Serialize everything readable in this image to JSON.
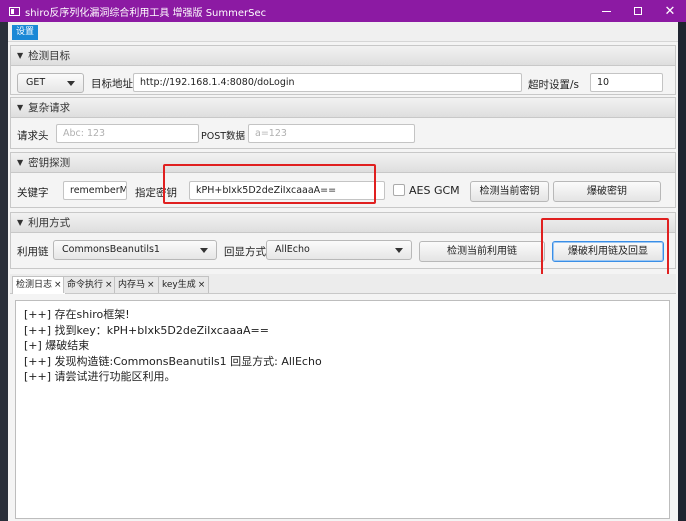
{
  "window": {
    "title": "shiro反序列化漏洞综合利用工具 增强版 SummerSec",
    "controls": {
      "minimize": "minimize-icon",
      "maximize": "maximize-icon",
      "close": "close-icon"
    }
  },
  "menu": {
    "settings_label": "设置"
  },
  "target_section": {
    "header": "检测目标",
    "method": "GET",
    "url_label": "目标地址",
    "url_value": "http://192.168.1.4:8080/doLogin",
    "timeout_label": "超时设置/s",
    "timeout_value": "10"
  },
  "complex_section": {
    "header": "复杂请求",
    "headers_label": "请求头",
    "headers_placeholder": "Abc: 123",
    "post_label": "POST数据",
    "post_placeholder": "a=123"
  },
  "key_section": {
    "header": "密钥探测",
    "keyword_label": "关键字",
    "keyword_value": "rememberMe",
    "key_label": "指定密钥",
    "key_value": "kPH+bIxk5D2deZiIxcaaaA==",
    "aes_gcm_label": "AES GCM",
    "aes_gcm_checked": false,
    "check_key_button": "检测当前密钥",
    "brute_key_button": "爆破密钥"
  },
  "exploit_section": {
    "header": "利用方式",
    "chain_label": "利用链",
    "chain_value": "CommonsBeanutils1",
    "echo_label": "回显方式",
    "echo_value": "AllEcho",
    "check_chain_button": "检测当前利用链",
    "brute_chain_button": "爆破利用链及回显"
  },
  "tabs": [
    {
      "label": "检测日志",
      "close": "×"
    },
    {
      "label": "命令执行",
      "close": "×"
    },
    {
      "label": "内存马",
      "close": "×"
    },
    {
      "label": "key生成",
      "close": "×"
    }
  ],
  "log_lines": [
    "[++] 存在shiro框架!",
    "[++] 找到key：kPH+bIxk5D2deZiIxcaaaA==",
    "[+] 爆破结束",
    "[++] 发现构造链:CommonsBeanutils1  回显方式: AllEcho",
    "[++] 请尝试进行功能区利用。"
  ],
  "colors": {
    "titlebar": "#8c1aa3",
    "settings_tab": "#1a88d6",
    "highlight_box": "#e02020"
  }
}
